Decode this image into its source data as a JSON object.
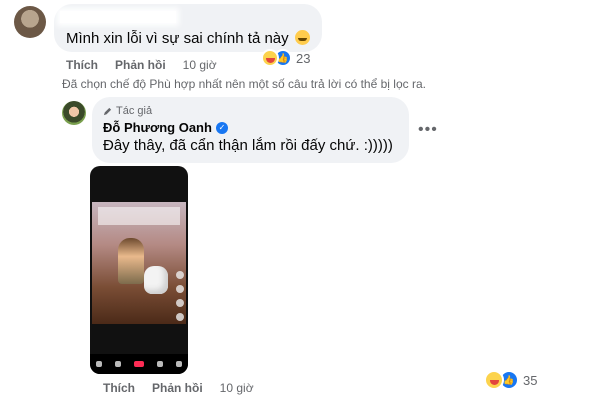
{
  "first_comment": {
    "text": "Mình xin lỗi vì sự sai chính tả này",
    "reactions": {
      "icons": [
        "laugh-emoji",
        "like-thumb"
      ],
      "count": "23"
    },
    "actions": {
      "like": "Thích",
      "reply": "Phản hồi",
      "time": "10 giờ"
    }
  },
  "filter_notice": "Đã chọn chế độ Phù hợp nhất nên một số câu trả lời có thể bị lọc ra.",
  "reply_comment": {
    "badge": "Tác giả",
    "author": "Đỗ Phương Oanh",
    "text": "Đây thây, đã cẩn thận lắm rồi đấy chứ. :)))))",
    "reactions": {
      "icons": [
        "laugh-emoji",
        "like-thumb"
      ],
      "count": "35"
    },
    "actions": {
      "like": "Thích",
      "reply": "Phản hồi",
      "time": "10 giờ"
    }
  },
  "colors": {
    "bubble": "#f0f2f5",
    "meta": "#65676b",
    "like_blue": "#1877f2"
  }
}
